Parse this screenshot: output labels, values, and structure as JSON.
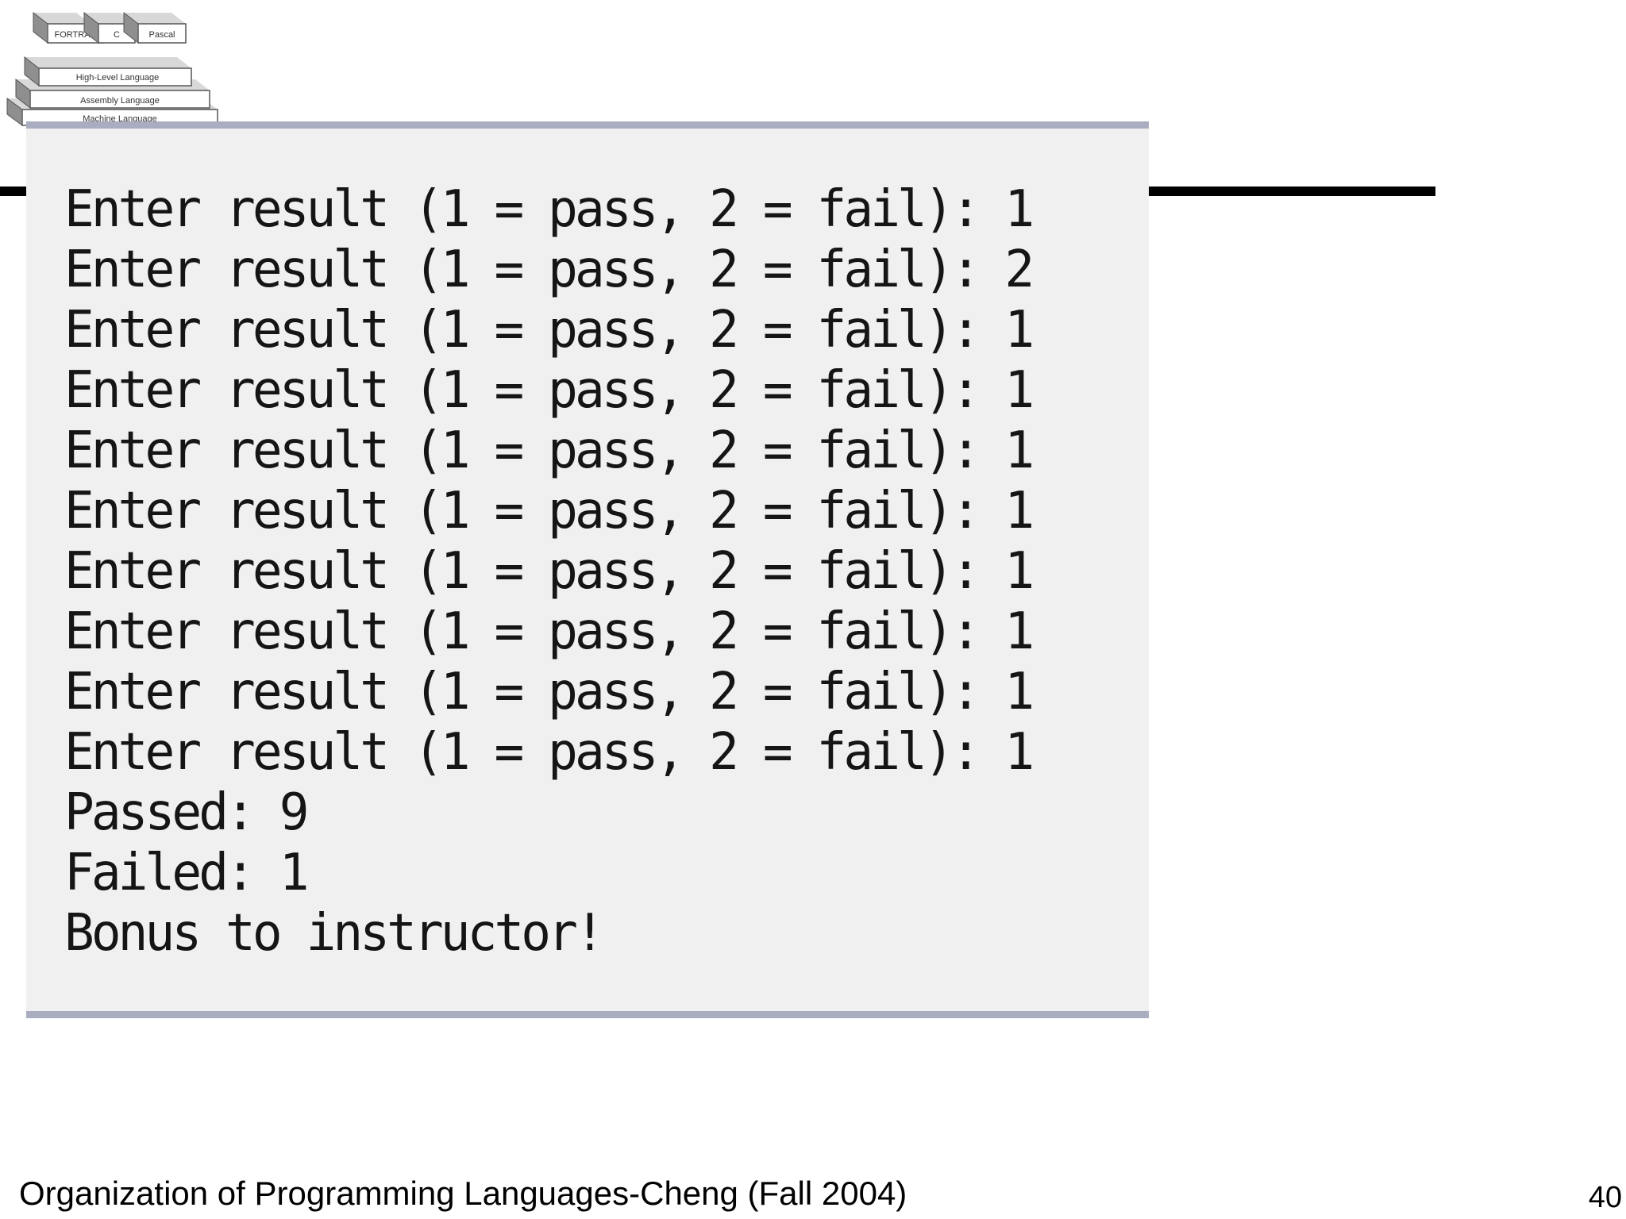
{
  "logo": {
    "labels": [
      "FORTRAN",
      "C",
      "Pascal",
      "High-Level Language",
      "Assembly Language",
      "Machine Language"
    ]
  },
  "console": {
    "lines": [
      "Enter result (1 = pass, 2 = fail): 1",
      "Enter result (1 = pass, 2 = fail): 2",
      "Enter result (1 = pass, 2 = fail): 1",
      "Enter result (1 = pass, 2 = fail): 1",
      "Enter result (1 = pass, 2 = fail): 1",
      "Enter result (1 = pass, 2 = fail): 1",
      "Enter result (1 = pass, 2 = fail): 1",
      "Enter result (1 = pass, 2 = fail): 1",
      "Enter result (1 = pass, 2 = fail): 1",
      "Enter result (1 = pass, 2 = fail): 1",
      "Passed: 9",
      "Failed: 1",
      "Bonus to instructor!"
    ]
  },
  "footer": {
    "title": "Organization of Programming Languages-Cheng (Fall 2004)",
    "page_number": "40"
  }
}
